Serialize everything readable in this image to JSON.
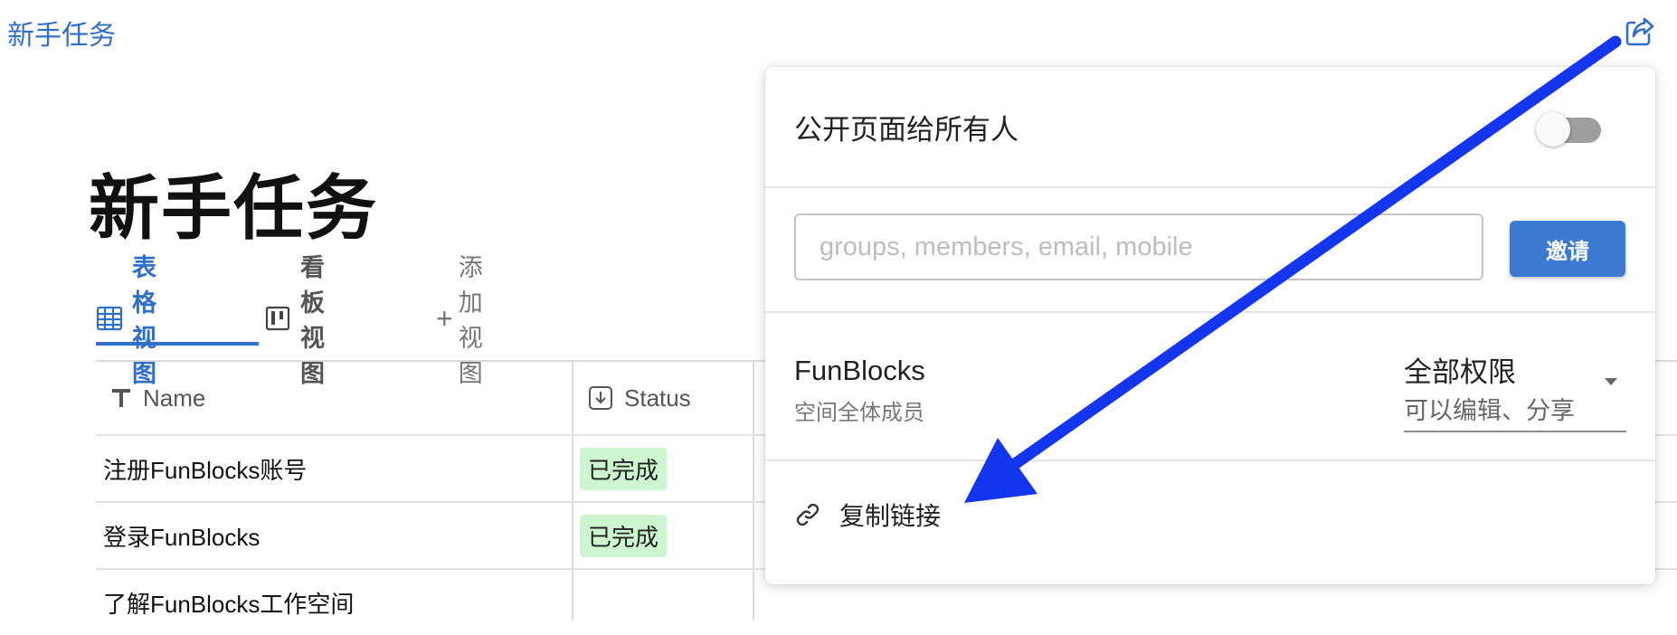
{
  "header": {
    "breadcrumb": "新手任务",
    "share_icon": "share-icon"
  },
  "page": {
    "title": "新手任务"
  },
  "views": {
    "tabs": [
      {
        "label": "表格视图",
        "icon": "table-icon",
        "active": true
      },
      {
        "label": "看板视图",
        "icon": "kanban-icon",
        "active": false
      }
    ],
    "add_label": "添加视图"
  },
  "table": {
    "columns": [
      {
        "label": "Name",
        "icon": "text-type-icon"
      },
      {
        "label": "Status",
        "icon": "select-icon"
      }
    ],
    "rows": [
      {
        "name": "注册FunBlocks账号",
        "status": "已完成"
      },
      {
        "name": "登录FunBlocks",
        "status": "已完成"
      },
      {
        "name": "了解FunBlocks工作空间",
        "status": ""
      }
    ]
  },
  "share_popover": {
    "public_label": "公开页面给所有人",
    "public_enabled": false,
    "invite_placeholder": "groups, members, email, mobile",
    "invite_value": "",
    "invite_button": "邀请",
    "member": {
      "name": "FunBlocks",
      "description": "空间全体成员"
    },
    "permission": {
      "title": "全部权限",
      "subtitle": "可以编辑、分享"
    },
    "copy_link_label": "复制链接",
    "copy_link_icon": "link-icon"
  },
  "annotation": {
    "arrow_color": "#1336ee"
  },
  "colors": {
    "accent": "#2f6fc9",
    "button": "#3b7ad0",
    "badge_bg": "#cdf5cf"
  }
}
